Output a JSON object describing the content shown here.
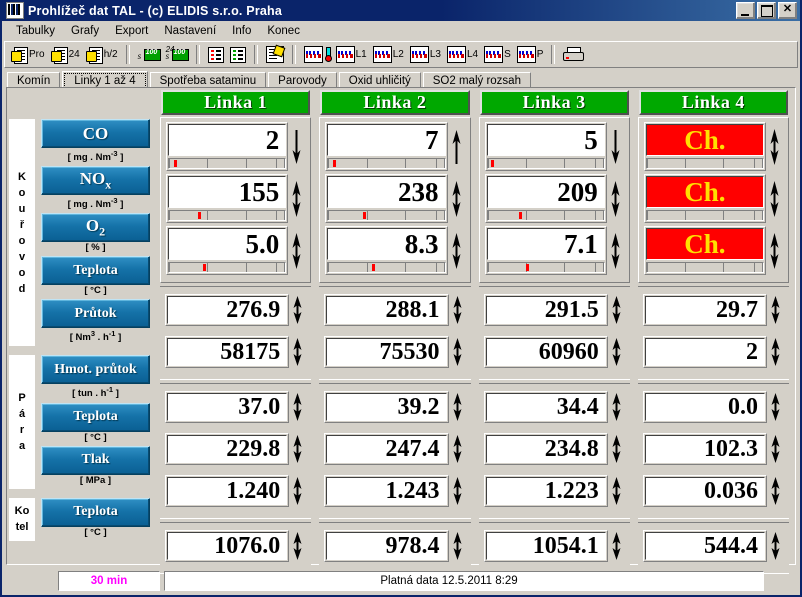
{
  "window": {
    "title": "Prohlížeč dat TAL - (c) ELIDIS s.r.o. Praha",
    "minimize_label": "_",
    "maximize_label": "",
    "close_label": "✕"
  },
  "menu": {
    "items": [
      "Tabulky",
      "Grafy",
      "Export",
      "Nastavení",
      "Info",
      "Konec"
    ]
  },
  "toolbar": {
    "buttons": [
      {
        "icon": "document-protocol-icon",
        "label": "Pro"
      },
      {
        "icon": "document-24h-icon",
        "label": "24"
      },
      {
        "icon": "document-half-hour-icon",
        "label": "h/2"
      },
      {
        "icon": "money-sum-icon",
        "label": ""
      },
      {
        "icon": "money-24h-icon",
        "label": ""
      },
      {
        "icon": "list-red-icon",
        "label": ""
      },
      {
        "icon": "list-green-icon",
        "label": ""
      },
      {
        "icon": "edit-note-icon",
        "label": ""
      },
      {
        "icon": "chart-thermometer-icon",
        "label": ""
      },
      {
        "icon": "chart-icon",
        "label": "L1"
      },
      {
        "icon": "chart-icon",
        "label": "L2"
      },
      {
        "icon": "chart-icon",
        "label": "L3"
      },
      {
        "icon": "chart-icon",
        "label": "L4"
      },
      {
        "icon": "chart-icon",
        "label": "S"
      },
      {
        "icon": "chart-icon",
        "label": "P"
      },
      {
        "icon": "printer-icon",
        "label": ""
      }
    ]
  },
  "tabs": {
    "items": [
      "Komín",
      "Linky 1 až 4",
      "Spotřeba sataminu",
      "Parovody",
      "Oxid uhličitý",
      "SO2 malý rozsah"
    ],
    "active_index": 1
  },
  "columns": [
    {
      "header": "Linka 1"
    },
    {
      "header": "Linka 2"
    },
    {
      "header": "Linka 3"
    },
    {
      "header": "Linka 4"
    }
  ],
  "groups": [
    {
      "name": "Kouřovod",
      "vertical_label": "Kouřovod",
      "rows": [
        {
          "label": "CO",
          "unit_prefix": "[ mg . Nm",
          "unit_sup": "-3",
          "unit_suffix": " ]",
          "type": "meter"
        },
        {
          "label": "NOx",
          "unit_prefix": "[ mg . Nm",
          "unit_sup": "-3",
          "unit_suffix": " ]",
          "type": "meter"
        },
        {
          "label": "O2",
          "unit_prefix": "[ % ]",
          "unit_sup": "",
          "unit_suffix": "",
          "type": "meter"
        },
        {
          "label": "Teplota",
          "unit_prefix": "[ °C ]",
          "unit_sup": "",
          "unit_suffix": "",
          "type": "plain"
        },
        {
          "label": "Průtok",
          "unit_prefix": "[ Nm",
          "unit_sup": "3",
          "unit_suffix": " . h-1 ]",
          "type": "plain"
        }
      ]
    },
    {
      "name": "Pára",
      "vertical_label": "Pára",
      "rows": [
        {
          "label": "Hmot. průtok",
          "unit_prefix": "[ tun . h-1 ]",
          "unit_sup": "",
          "unit_suffix": "",
          "type": "plain"
        },
        {
          "label": "Teplota",
          "unit_prefix": "[ °C ]",
          "unit_sup": "",
          "unit_suffix": "",
          "type": "plain"
        },
        {
          "label": "Tlak",
          "unit_prefix": "[ MPa ]",
          "unit_sup": "",
          "unit_suffix": "",
          "type": "plain"
        }
      ]
    },
    {
      "name": "Kotel",
      "vertical_label": "Kotel",
      "rows": [
        {
          "label": "Teplota",
          "unit_prefix": "[ °C ]",
          "unit_sup": "",
          "unit_suffix": "",
          "type": "plain"
        }
      ]
    }
  ],
  "readings": {
    "kourovod": {
      "co": [
        {
          "value": "2",
          "fault": false,
          "trend": "down",
          "mark": 4
        },
        {
          "value": "7",
          "fault": false,
          "trend": "up",
          "mark": 4
        },
        {
          "value": "5",
          "fault": false,
          "trend": "down",
          "mark": 3
        },
        {
          "value": "Ch.",
          "fault": true,
          "trend": "both",
          "mark": -1
        }
      ],
      "nox": [
        {
          "value": "155",
          "fault": false,
          "trend": "both",
          "mark": 25
        },
        {
          "value": "238",
          "fault": false,
          "trend": "both",
          "mark": 30
        },
        {
          "value": "209",
          "fault": false,
          "trend": "both",
          "mark": 27
        },
        {
          "value": "Ch.",
          "fault": true,
          "trend": "both",
          "mark": -1
        }
      ],
      "o2": [
        {
          "value": "5.0",
          "fault": false,
          "trend": "both",
          "mark": 29
        },
        {
          "value": "8.3",
          "fault": false,
          "trend": "both",
          "mark": 38
        },
        {
          "value": "7.1",
          "fault": false,
          "trend": "both",
          "mark": 33
        },
        {
          "value": "Ch.",
          "fault": true,
          "trend": "both",
          "mark": -1
        }
      ],
      "teplota": [
        {
          "value": "276.9",
          "trend": "both"
        },
        {
          "value": "288.1",
          "trend": "both"
        },
        {
          "value": "291.5",
          "trend": "both"
        },
        {
          "value": "29.7",
          "trend": "both"
        }
      ],
      "prutok": [
        {
          "value": "58175",
          "trend": "both"
        },
        {
          "value": "75530",
          "trend": "both"
        },
        {
          "value": "60960",
          "trend": "both"
        },
        {
          "value": "2",
          "trend": "both"
        }
      ]
    },
    "para": {
      "hmot_prutok": [
        {
          "value": "37.0",
          "trend": "both"
        },
        {
          "value": "39.2",
          "trend": "both"
        },
        {
          "value": "34.4",
          "trend": "both"
        },
        {
          "value": "0.0",
          "trend": "both"
        }
      ],
      "teplota": [
        {
          "value": "229.8",
          "trend": "both"
        },
        {
          "value": "247.4",
          "trend": "both"
        },
        {
          "value": "234.8",
          "trend": "both"
        },
        {
          "value": "102.3",
          "trend": "both"
        }
      ],
      "tlak": [
        {
          "value": "1.240",
          "trend": "both"
        },
        {
          "value": "1.243",
          "trend": "both"
        },
        {
          "value": "1.223",
          "trend": "both"
        },
        {
          "value": "0.036",
          "trend": "both"
        }
      ]
    },
    "kotel": {
      "teplota": [
        {
          "value": "1076.0",
          "trend": "both"
        },
        {
          "value": "978.4",
          "trend": "both"
        },
        {
          "value": "1054.1",
          "trend": "both"
        },
        {
          "value": "544.4",
          "trend": "both"
        }
      ]
    }
  },
  "statusbar": {
    "interval": "30 min",
    "message": "Platná data 12.5.2011  8:29"
  },
  "colors": {
    "header_green": "#00a800",
    "fault_red": "#ff0000",
    "fault_text": "#ffe000",
    "button_blue": "#1572a8",
    "interval_magenta": "#ff00ff",
    "marker_red": "#ff0000",
    "titlebar_blue": "#0a246a"
  }
}
